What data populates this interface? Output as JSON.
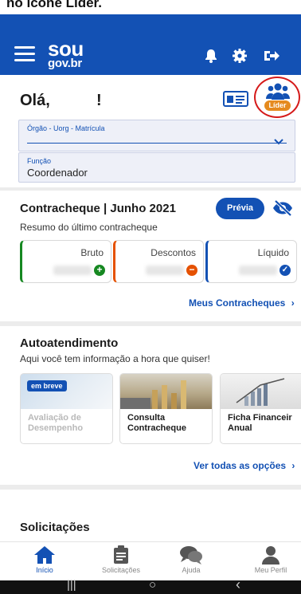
{
  "top_caption": "no ícone Líder.",
  "app": {
    "brand_line1": "sou",
    "brand_line2": "gov.br"
  },
  "header": {
    "greeting": "Olá,",
    "greeting_end": "!",
    "leader_badge": "Líder"
  },
  "fields": {
    "orgao": {
      "label": "Órgão - Uorg - Matrícula",
      "value": ""
    },
    "funcao": {
      "label": "Função",
      "value": "Coordenador"
    }
  },
  "paycheck": {
    "title": "Contracheque | Junho 2021",
    "subtitle": "Resumo do último contracheque",
    "preview_button": "Prévia",
    "cards": [
      {
        "label": "Bruto",
        "icon": "plus-circle-icon",
        "color": "#168821"
      },
      {
        "label": "Descontos",
        "icon": "minus-circle-icon",
        "color": "#e55100"
      },
      {
        "label": "Líquido",
        "icon": "check-circle-icon",
        "color": "#1351b4"
      }
    ],
    "link": "Meus Contracheques"
  },
  "self_service": {
    "title": "Autoatendimento",
    "subtitle": "Aqui você tem informação a hora que quiser!",
    "items": [
      {
        "line1": "Avaliação de",
        "line2": "Desempenho",
        "badge": "em breve"
      },
      {
        "line1": "Consulta",
        "line2": "Contracheque"
      },
      {
        "line1": "Ficha Financeir",
        "line2": "Anual"
      }
    ],
    "link": "Ver todas as opções"
  },
  "requests": {
    "title": "Solicitações"
  },
  "bottom_nav": [
    {
      "label": "Início",
      "icon": "home-icon",
      "active": true
    },
    {
      "label": "Solicitações",
      "icon": "clipboard-icon",
      "active": false
    },
    {
      "label": "Ajuda",
      "icon": "chat-bubbles-icon",
      "active": false
    },
    {
      "label": "Meu Perfil",
      "icon": "user-icon",
      "active": false
    }
  ],
  "system_nav": {
    "recents": "|||",
    "home": "○",
    "back": "‹"
  },
  "colors": {
    "primary": "#1351b4",
    "leader_badge": "#e58a1f",
    "highlight_circle": "#d51a1a"
  }
}
